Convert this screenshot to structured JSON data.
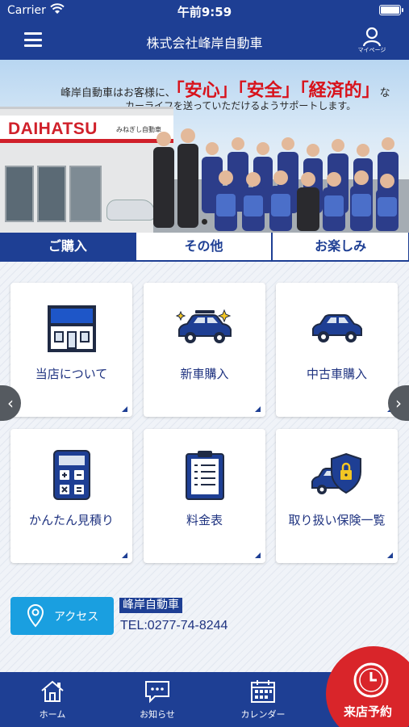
{
  "status": {
    "carrier": "Carrier",
    "time": "午前9:59"
  },
  "header": {
    "title": "株式会社峰岸自動車",
    "mypage_label": "マイページ"
  },
  "hero": {
    "line1_pre": "峰岸自動車はお客様に、",
    "line1_em1": "「安心」",
    "line1_em2": "「安全」",
    "line1_em3": "「経済的」",
    "line1_post": "な",
    "line2": "カーライフを送っていただけるようサポートします。",
    "store_brand": "DAIHATSU",
    "store_small": "みねぎし自動車"
  },
  "tabs": [
    {
      "label": "ご購入",
      "active": true
    },
    {
      "label": "その他",
      "active": false
    },
    {
      "label": "お楽しみ",
      "active": false
    }
  ],
  "tiles": [
    {
      "label": "当店について",
      "icon": "shop-icon"
    },
    {
      "label": "新車購入",
      "icon": "new-car-icon"
    },
    {
      "label": "中古車購入",
      "icon": "used-car-icon"
    },
    {
      "label": "かんたん見積り",
      "icon": "calculator-icon"
    },
    {
      "label": "料金表",
      "icon": "price-list-icon"
    },
    {
      "label": "取り扱い保険一覧",
      "icon": "insurance-icon"
    }
  ],
  "access": {
    "button_label": "アクセス",
    "shop_name": "峰岸自動車",
    "tel": "TEL:0277-74-8244"
  },
  "bottom_nav": {
    "home": "ホーム",
    "news": "お知らせ",
    "calendar": "カレンダー",
    "reserve": "来店予約"
  },
  "colors": {
    "primary": "#1e3f94",
    "accent": "#1a9fe0",
    "reserve": "#d9252a"
  }
}
